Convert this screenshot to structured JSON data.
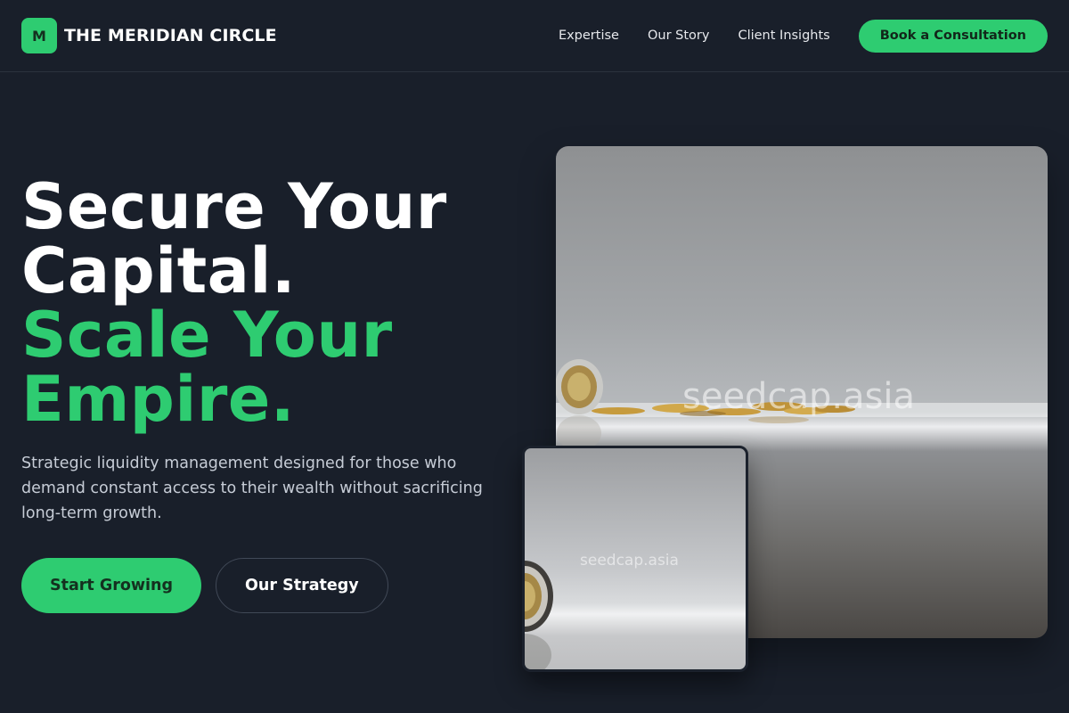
{
  "nav": {
    "logo_letter": "M",
    "brand_name": "THE MERIDIAN CIRCLE",
    "links": [
      "Expertise",
      "Our Story",
      "Client Insights"
    ],
    "cta_label": "Book a Consultation"
  },
  "hero": {
    "headline_line1": "Secure Your",
    "headline_line2": "Capital.",
    "headline_line3": "Scale Your",
    "headline_line4": "Empire.",
    "lede": "Strategic liquidity management designed for those who demand constant access to their wealth without sacrificing long-term growth.",
    "primary_cta": "Start Growing",
    "secondary_cta": "Our Strategy"
  },
  "images": {
    "main_watermark": "seedcap.asia",
    "small_watermark": "seedcap.asia"
  },
  "colors": {
    "accent": "#2ecc71",
    "background": "#191f2a",
    "lede_text": "#c6ccd6"
  }
}
